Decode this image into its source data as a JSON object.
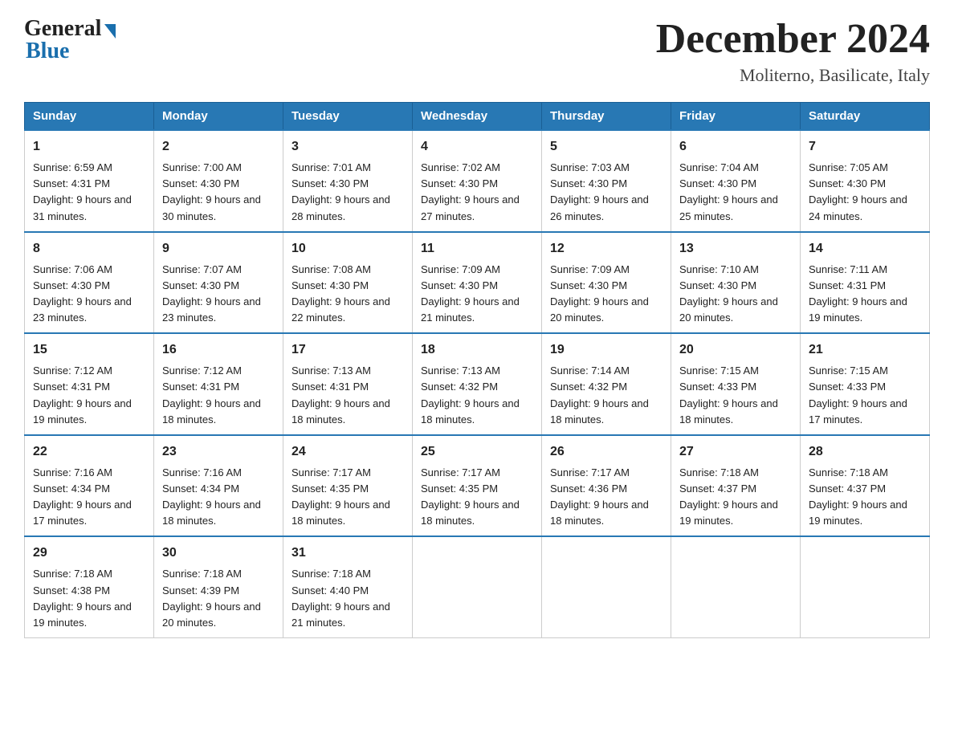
{
  "header": {
    "logo_general": "General",
    "logo_blue": "Blue",
    "month_title": "December 2024",
    "location": "Moliterno, Basilicate, Italy"
  },
  "weekdays": [
    "Sunday",
    "Monday",
    "Tuesday",
    "Wednesday",
    "Thursday",
    "Friday",
    "Saturday"
  ],
  "weeks": [
    [
      {
        "day": "1",
        "sunrise": "Sunrise: 6:59 AM",
        "sunset": "Sunset: 4:31 PM",
        "daylight": "Daylight: 9 hours and 31 minutes."
      },
      {
        "day": "2",
        "sunrise": "Sunrise: 7:00 AM",
        "sunset": "Sunset: 4:30 PM",
        "daylight": "Daylight: 9 hours and 30 minutes."
      },
      {
        "day": "3",
        "sunrise": "Sunrise: 7:01 AM",
        "sunset": "Sunset: 4:30 PM",
        "daylight": "Daylight: 9 hours and 28 minutes."
      },
      {
        "day": "4",
        "sunrise": "Sunrise: 7:02 AM",
        "sunset": "Sunset: 4:30 PM",
        "daylight": "Daylight: 9 hours and 27 minutes."
      },
      {
        "day": "5",
        "sunrise": "Sunrise: 7:03 AM",
        "sunset": "Sunset: 4:30 PM",
        "daylight": "Daylight: 9 hours and 26 minutes."
      },
      {
        "day": "6",
        "sunrise": "Sunrise: 7:04 AM",
        "sunset": "Sunset: 4:30 PM",
        "daylight": "Daylight: 9 hours and 25 minutes."
      },
      {
        "day": "7",
        "sunrise": "Sunrise: 7:05 AM",
        "sunset": "Sunset: 4:30 PM",
        "daylight": "Daylight: 9 hours and 24 minutes."
      }
    ],
    [
      {
        "day": "8",
        "sunrise": "Sunrise: 7:06 AM",
        "sunset": "Sunset: 4:30 PM",
        "daylight": "Daylight: 9 hours and 23 minutes."
      },
      {
        "day": "9",
        "sunrise": "Sunrise: 7:07 AM",
        "sunset": "Sunset: 4:30 PM",
        "daylight": "Daylight: 9 hours and 23 minutes."
      },
      {
        "day": "10",
        "sunrise": "Sunrise: 7:08 AM",
        "sunset": "Sunset: 4:30 PM",
        "daylight": "Daylight: 9 hours and 22 minutes."
      },
      {
        "day": "11",
        "sunrise": "Sunrise: 7:09 AM",
        "sunset": "Sunset: 4:30 PM",
        "daylight": "Daylight: 9 hours and 21 minutes."
      },
      {
        "day": "12",
        "sunrise": "Sunrise: 7:09 AM",
        "sunset": "Sunset: 4:30 PM",
        "daylight": "Daylight: 9 hours and 20 minutes."
      },
      {
        "day": "13",
        "sunrise": "Sunrise: 7:10 AM",
        "sunset": "Sunset: 4:30 PM",
        "daylight": "Daylight: 9 hours and 20 minutes."
      },
      {
        "day": "14",
        "sunrise": "Sunrise: 7:11 AM",
        "sunset": "Sunset: 4:31 PM",
        "daylight": "Daylight: 9 hours and 19 minutes."
      }
    ],
    [
      {
        "day": "15",
        "sunrise": "Sunrise: 7:12 AM",
        "sunset": "Sunset: 4:31 PM",
        "daylight": "Daylight: 9 hours and 19 minutes."
      },
      {
        "day": "16",
        "sunrise": "Sunrise: 7:12 AM",
        "sunset": "Sunset: 4:31 PM",
        "daylight": "Daylight: 9 hours and 18 minutes."
      },
      {
        "day": "17",
        "sunrise": "Sunrise: 7:13 AM",
        "sunset": "Sunset: 4:31 PM",
        "daylight": "Daylight: 9 hours and 18 minutes."
      },
      {
        "day": "18",
        "sunrise": "Sunrise: 7:13 AM",
        "sunset": "Sunset: 4:32 PM",
        "daylight": "Daylight: 9 hours and 18 minutes."
      },
      {
        "day": "19",
        "sunrise": "Sunrise: 7:14 AM",
        "sunset": "Sunset: 4:32 PM",
        "daylight": "Daylight: 9 hours and 18 minutes."
      },
      {
        "day": "20",
        "sunrise": "Sunrise: 7:15 AM",
        "sunset": "Sunset: 4:33 PM",
        "daylight": "Daylight: 9 hours and 18 minutes."
      },
      {
        "day": "21",
        "sunrise": "Sunrise: 7:15 AM",
        "sunset": "Sunset: 4:33 PM",
        "daylight": "Daylight: 9 hours and 17 minutes."
      }
    ],
    [
      {
        "day": "22",
        "sunrise": "Sunrise: 7:16 AM",
        "sunset": "Sunset: 4:34 PM",
        "daylight": "Daylight: 9 hours and 17 minutes."
      },
      {
        "day": "23",
        "sunrise": "Sunrise: 7:16 AM",
        "sunset": "Sunset: 4:34 PM",
        "daylight": "Daylight: 9 hours and 18 minutes."
      },
      {
        "day": "24",
        "sunrise": "Sunrise: 7:17 AM",
        "sunset": "Sunset: 4:35 PM",
        "daylight": "Daylight: 9 hours and 18 minutes."
      },
      {
        "day": "25",
        "sunrise": "Sunrise: 7:17 AM",
        "sunset": "Sunset: 4:35 PM",
        "daylight": "Daylight: 9 hours and 18 minutes."
      },
      {
        "day": "26",
        "sunrise": "Sunrise: 7:17 AM",
        "sunset": "Sunset: 4:36 PM",
        "daylight": "Daylight: 9 hours and 18 minutes."
      },
      {
        "day": "27",
        "sunrise": "Sunrise: 7:18 AM",
        "sunset": "Sunset: 4:37 PM",
        "daylight": "Daylight: 9 hours and 19 minutes."
      },
      {
        "day": "28",
        "sunrise": "Sunrise: 7:18 AM",
        "sunset": "Sunset: 4:37 PM",
        "daylight": "Daylight: 9 hours and 19 minutes."
      }
    ],
    [
      {
        "day": "29",
        "sunrise": "Sunrise: 7:18 AM",
        "sunset": "Sunset: 4:38 PM",
        "daylight": "Daylight: 9 hours and 19 minutes."
      },
      {
        "day": "30",
        "sunrise": "Sunrise: 7:18 AM",
        "sunset": "Sunset: 4:39 PM",
        "daylight": "Daylight: 9 hours and 20 minutes."
      },
      {
        "day": "31",
        "sunrise": "Sunrise: 7:18 AM",
        "sunset": "Sunset: 4:40 PM",
        "daylight": "Daylight: 9 hours and 21 minutes."
      },
      null,
      null,
      null,
      null
    ]
  ]
}
